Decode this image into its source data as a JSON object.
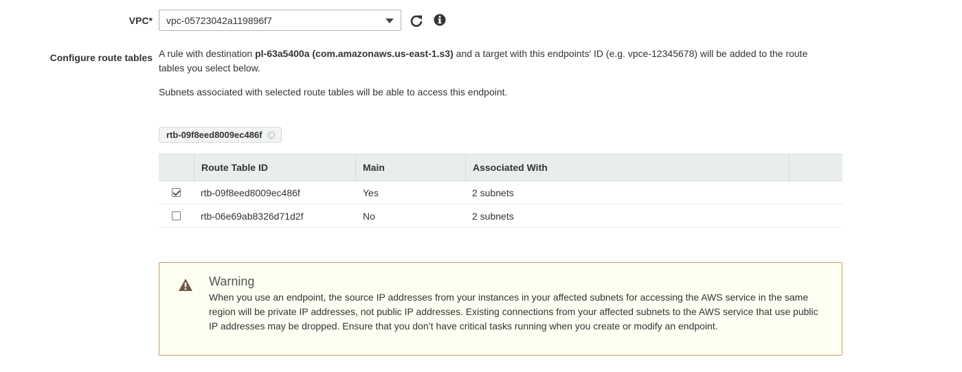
{
  "vpc": {
    "label": "VPC*",
    "selected": "vpc-05723042a119896f7"
  },
  "route_tables": {
    "label": "Configure route tables",
    "desc_prefix": "A rule with destination ",
    "desc_bold": "pl-63a5400a (com.amazonaws.us-east-1.s3)",
    "desc_suffix": " and a target with this endpoints' ID (e.g. vpce-12345678) will be added to the route tables you select below.",
    "subnets_note": "Subnets associated with selected route tables will be able to access this endpoint.",
    "token": "rtb-09f8eed8009ec486f",
    "table": {
      "headers": [
        "Route Table ID",
        "Main",
        "Associated With"
      ],
      "rows": [
        {
          "checked": true,
          "id": "rtb-09f8eed8009ec486f",
          "main": "Yes",
          "assoc": "2 subnets"
        },
        {
          "checked": false,
          "id": "rtb-06e69ab8326d71d2f",
          "main": "No",
          "assoc": "2 subnets"
        }
      ]
    }
  },
  "warning": {
    "icon": "warning-triangle-icon",
    "title": "Warning",
    "body": "When you use an endpoint, the source IP addresses from your instances in your affected subnets for accessing the AWS service in the same region will be private IP addresses, not public IP addresses. Existing connections from your affected subnets to the AWS service that use public IP addresses may be dropped. Ensure that you don’t have critical tasks running when you create or modify an endpoint."
  },
  "icons": {
    "refresh": "refresh-icon",
    "info": "info-icon"
  },
  "colors": {
    "warning_border": "#c6a15b",
    "warning_bg": "#fffef2",
    "table_header_bg": "#eaeded"
  }
}
